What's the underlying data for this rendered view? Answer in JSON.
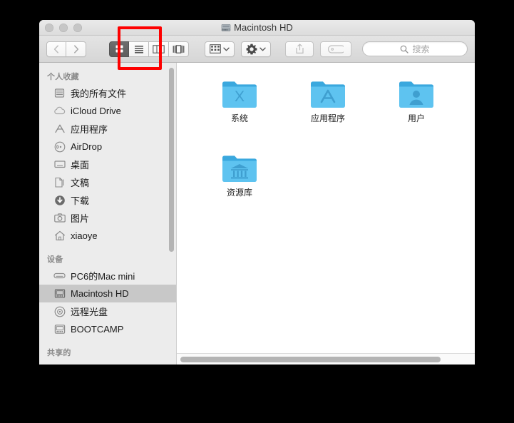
{
  "window": {
    "title": "Macintosh HD",
    "title_icon": "hard-drive-icon",
    "traffic_lights": [
      "close-button",
      "minimize-button",
      "zoom-button"
    ]
  },
  "toolbar": {
    "back_label": "‹",
    "forward_label": "›",
    "view_modes": [
      {
        "name": "icon-view",
        "label": "图标视图",
        "active": true
      },
      {
        "name": "list-view",
        "label": "列表视图",
        "active": false
      },
      {
        "name": "column-view",
        "label": "分栏视图",
        "active": false
      },
      {
        "name": "coverflow-view",
        "label": "Cover Flow 视图",
        "active": false
      }
    ],
    "arrange_label": "排列方式",
    "action_label": "操作",
    "share_label": "共享",
    "tag_label": "标记"
  },
  "search": {
    "placeholder": "搜索",
    "value": "",
    "icon": "search-icon"
  },
  "sidebar": {
    "sections": [
      {
        "header": "个人收藏",
        "items": [
          {
            "label": "我的所有文件",
            "icon": "all-files-icon",
            "selected": false
          },
          {
            "label": "iCloud Drive",
            "icon": "icloud-icon",
            "selected": false
          },
          {
            "label": "应用程序",
            "icon": "applications-icon",
            "selected": false
          },
          {
            "label": "AirDrop",
            "icon": "airdrop-icon",
            "selected": false
          },
          {
            "label": "桌面",
            "icon": "desktop-icon",
            "selected": false
          },
          {
            "label": "文稿",
            "icon": "documents-icon",
            "selected": false
          },
          {
            "label": "下载",
            "icon": "downloads-icon",
            "selected": false
          },
          {
            "label": "图片",
            "icon": "pictures-icon",
            "selected": false
          },
          {
            "label": "xiaoye",
            "icon": "home-icon",
            "selected": false
          }
        ]
      },
      {
        "header": "设备",
        "items": [
          {
            "label": "PC6的Mac mini",
            "icon": "computer-icon",
            "selected": false
          },
          {
            "label": "Macintosh HD",
            "icon": "hard-drive-icon",
            "selected": true
          },
          {
            "label": "远程光盘",
            "icon": "optical-disc-icon",
            "selected": false
          },
          {
            "label": "BOOTCAMP",
            "icon": "hard-drive-icon",
            "selected": false
          }
        ]
      },
      {
        "header": "共享的",
        "items": []
      }
    ]
  },
  "content": {
    "items": [
      {
        "label": "系统",
        "icon": "folder-system-icon",
        "glyph": "X"
      },
      {
        "label": "应用程序",
        "icon": "folder-applications-icon",
        "glyph": "A"
      },
      {
        "label": "用户",
        "icon": "folder-users-icon",
        "glyph": "person"
      },
      {
        "label": "资源库",
        "icon": "folder-library-icon",
        "glyph": "bank"
      }
    ]
  },
  "colors": {
    "folder_blue": "#5ec3f0",
    "folder_blue_dark": "#3aa8de",
    "highlight_red": "#fe0000",
    "selection_gray": "#c8c8c8",
    "sidebar_bg": "#ececec"
  },
  "annotation": {
    "highlight_target": "icon-view-button"
  }
}
